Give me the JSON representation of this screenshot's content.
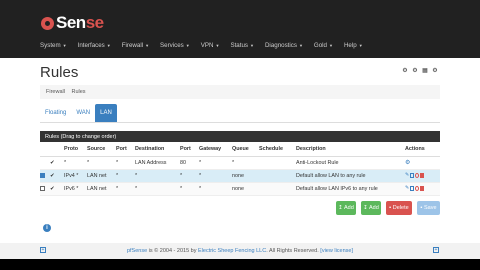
{
  "brand": {
    "logo_prefix": "",
    "logo_main": "Sen",
    "logo_accent": "se"
  },
  "menu": [
    {
      "label": "System"
    },
    {
      "label": "Interfaces"
    },
    {
      "label": "Firewall"
    },
    {
      "label": "Services"
    },
    {
      "label": "VPN"
    },
    {
      "label": "Status"
    },
    {
      "label": "Diagnostics"
    },
    {
      "label": "Gold"
    },
    {
      "label": "Help"
    }
  ],
  "page": {
    "title": "Rules"
  },
  "breadcrumb": {
    "items": [
      "Firewall",
      "Rules"
    ]
  },
  "tabs": [
    {
      "label": "Floating",
      "active": false
    },
    {
      "label": "WAN",
      "active": false
    },
    {
      "label": "LAN",
      "active": true
    }
  ],
  "panel": {
    "heading": "Rules (Drag to change order)"
  },
  "table": {
    "columns": [
      "",
      "",
      "Proto",
      "Source",
      "Port",
      "Destination",
      "Port",
      "Gateway",
      "Queue",
      "Schedule",
      "Description",
      "Actions"
    ],
    "rows": [
      {
        "check": "",
        "status": "✔",
        "proto": "*",
        "source": "*",
        "port": "*",
        "destination": "LAN Address",
        "dport": "80",
        "gateway": "*",
        "queue": "*",
        "schedule": "",
        "description": "Anti-Lockout Rule"
      },
      {
        "check": "checked",
        "status": "✔",
        "proto": "IPv4 *",
        "source": "LAN net",
        "port": "*",
        "destination": "*",
        "dport": "*",
        "gateway": "*",
        "queue": "none",
        "schedule": "",
        "description": "Default allow LAN to any rule"
      },
      {
        "check": "",
        "status": "✔",
        "proto": "IPv6 *",
        "source": "LAN net",
        "port": "*",
        "destination": "*",
        "dport": "*",
        "gateway": "*",
        "queue": "none",
        "schedule": "",
        "description": "Default allow LAN IPv6 to any rule"
      }
    ]
  },
  "buttons": {
    "add_top": "Add",
    "add_bottom": "Add",
    "delete": "Delete",
    "save": "Save"
  },
  "footer": {
    "brand": "pfSense",
    "text": " is © 2004 - 2015 by ",
    "company": "Electric Sheep Fencing LLC",
    "rights": ". All Rights Reserved. ",
    "license": "[view license]"
  },
  "colors": {
    "navbar": "#212121",
    "accent": "#3a7fbf",
    "danger": "#d9534f",
    "success": "#5cb85c"
  }
}
